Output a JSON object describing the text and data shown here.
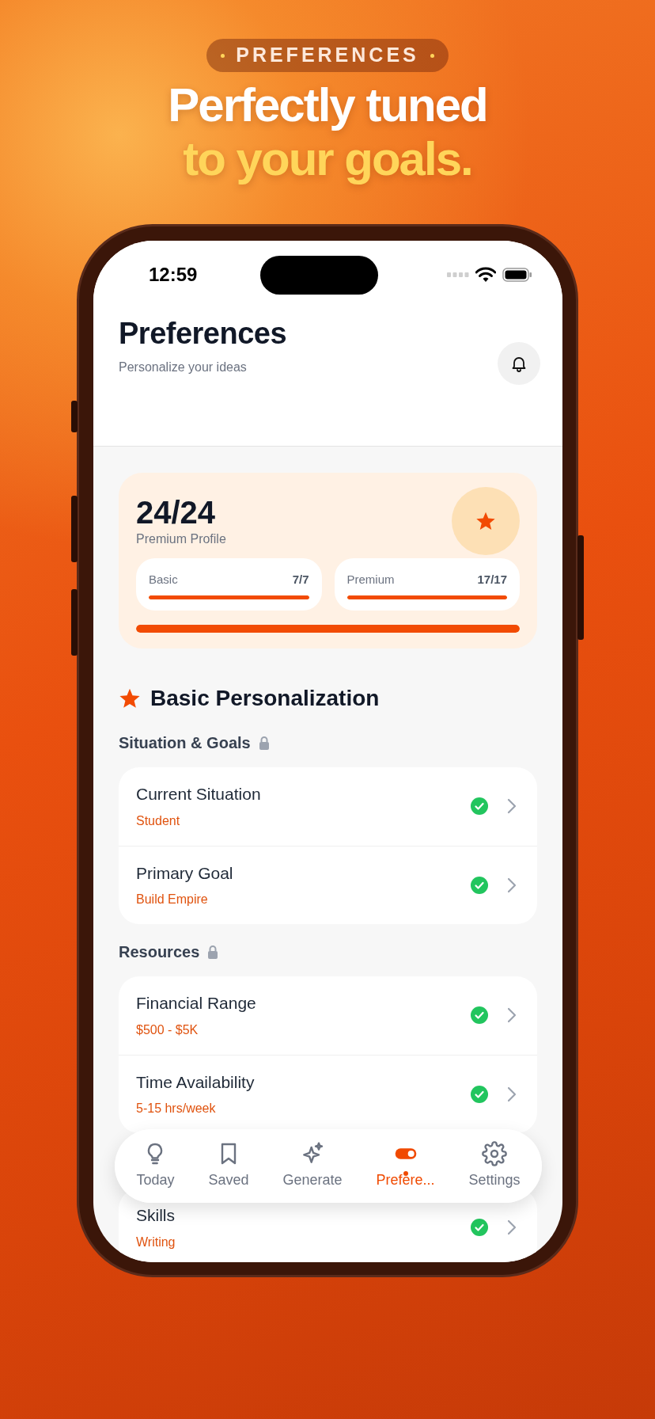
{
  "badge": "PREFERENCES",
  "headline": {
    "line_1": "Perfectly tuned",
    "line_2": "to your goals."
  },
  "status_bar": {
    "time": "12:59"
  },
  "header": {
    "title": "Preferences",
    "subtitle": "Personalize your ideas"
  },
  "progress_card": {
    "score": "24/24",
    "caption": "Premium Profile",
    "level": 1,
    "tiers": [
      {
        "label": "Basic",
        "count": "7/7",
        "level": 1
      },
      {
        "label": "Premium",
        "count": "17/17",
        "level": 1
      }
    ]
  },
  "section": {
    "title": "Basic Personalization",
    "groups": [
      {
        "title": "Situation & Goals",
        "locked": true,
        "rows": [
          {
            "label": "Current Situation",
            "value": "Student",
            "done": true
          },
          {
            "label": "Primary Goal",
            "value": "Build Empire",
            "done": true
          }
        ]
      },
      {
        "title": "Resources",
        "locked": true,
        "rows": [
          {
            "label": "Financial Range",
            "value": "$500 - $5K",
            "done": true
          },
          {
            "label": "Time Availability",
            "value": "5-15 hrs/week",
            "done": true
          }
        ]
      },
      {
        "rows": [
          {
            "label": "Skills",
            "value": "Writing",
            "done": true
          }
        ]
      }
    ]
  },
  "tabs": [
    {
      "label": "Today",
      "kind": "bulb",
      "selected": false
    },
    {
      "label": "Saved",
      "kind": "bookmark",
      "selected": false
    },
    {
      "label": "Generate",
      "kind": "sparkles",
      "selected": false
    },
    {
      "label": "Prefere...",
      "kind": "toggle",
      "selected": true
    },
    {
      "label": "Settings",
      "kind": "gear",
      "selected": false
    }
  ]
}
